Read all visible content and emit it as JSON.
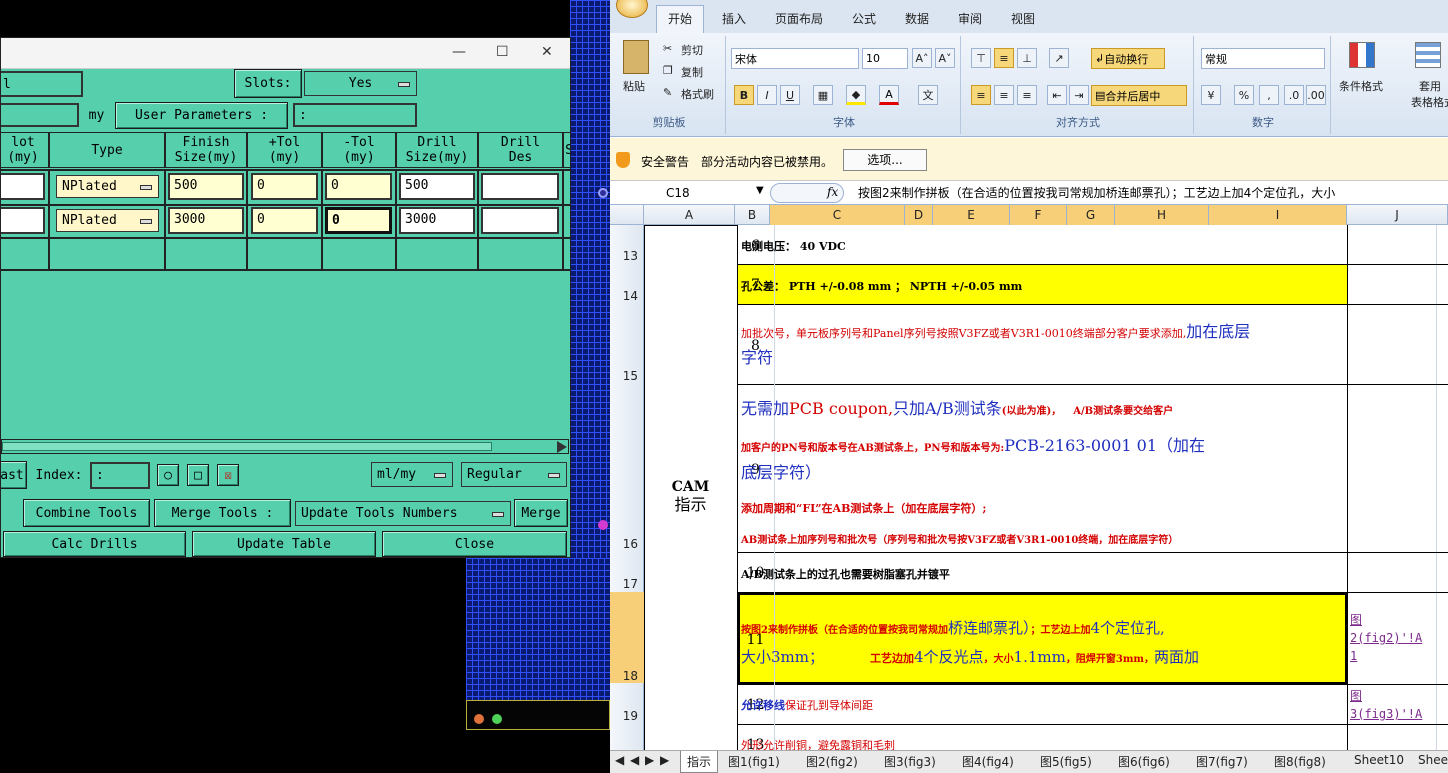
{
  "cam": {
    "row1_field": "l",
    "slots_label": "Slots:",
    "slots_value": "Yes",
    "units_suffix": "my",
    "user_params_label": "User Parameters :",
    "headers": {
      "slot": "lot",
      "slot2": "(my)",
      "type": "Type",
      "finish1": "Finish",
      "finish2": "Size(my)",
      "ptol1": "+Tol",
      "ptol2": "(my)",
      "mtol1": "-Tol",
      "mtol2": "(my)",
      "drill1": "Drill",
      "drill2": "Size(my)",
      "des1": "Drill",
      "des2": "Des",
      "extra": "S"
    },
    "rows": [
      {
        "type": "NPlated",
        "finish": "500",
        "ptol": "0",
        "mtol": "0",
        "drill": "500",
        "des": ""
      },
      {
        "type": "NPlated",
        "finish": "3000",
        "ptol": "0",
        "mtol": "0",
        "drill": "3000",
        "des": ""
      }
    ],
    "bottom": {
      "ast": "ast",
      "index_label": "Index:",
      "units": "ml/my",
      "mode": "Regular",
      "combine": "Combine Tools",
      "merge_tools": "Merge Tools :",
      "update_numbers": "Update Tools Numbers",
      "merge": "Merge",
      "calc": "Calc Drills",
      "update_table": "Update Table",
      "close": "Close"
    }
  },
  "excel": {
    "tabs": [
      "开始",
      "插入",
      "页面布局",
      "公式",
      "数据",
      "审阅",
      "视图"
    ],
    "clipboard": {
      "paste": "粘贴",
      "cut": "剪切",
      "copy": "复制",
      "format_painter": "格式刷",
      "label": "剪贴板"
    },
    "font": {
      "name": "宋体",
      "size": "10",
      "label": "字体"
    },
    "align": {
      "wrap": "自动换行",
      "merge": "合并后居中",
      "label": "对齐方式"
    },
    "number": {
      "format": "常规",
      "label": "数字"
    },
    "styles": {
      "cond": "条件格式",
      "table1": "套用",
      "table2": "表格格式"
    },
    "security": {
      "title": "安全警告",
      "msg": "部分活动内容已被禁用。",
      "btn": "选项..."
    },
    "namebox": "C18",
    "formula": "按图2来制作拼板（在合适的位置按我司常规加桥连邮票孔）；工艺边上加4个定位孔，大小",
    "cols": [
      "A",
      "B",
      "C",
      "D",
      "E",
      "F",
      "G",
      "H",
      "I",
      "J"
    ],
    "rownums": [
      "13",
      "14",
      "15",
      "16",
      "17",
      "18",
      "19"
    ],
    "cam_label1": "CAM",
    "cam_label2": "指示",
    "r6": {
      "n": "6",
      "t": "电测电压： 40 VDC"
    },
    "r7": {
      "n": "7",
      "t": "孔公差： PTH +/-0.08 mm    ；  NPTH +/-0.05 mm"
    },
    "r8": {
      "n": "8",
      "a": "加批次号，单元板序列号和Panel序列号按照V3FZ或者V3R1-0010终端部分客户要求添加,",
      "b": "加在底层",
      "c": "字符"
    },
    "r9": {
      "n": "9",
      "l1a": "无需加",
      "l1b": "PCB coupon,",
      "l1c": "只加A/B测试条",
      "l1d": "(以此为准)，",
      "l1e": "A/B测试条要交给客户",
      "l2a": "加客户的PN号和版本号在AB测试条上，PN号和版本号为:",
      "l2b": "PCB-2163-0001 01（加在",
      "l2c": "底层字符）",
      "l3": "添加周期和“FL”在AB测试条上（加在底层字符）;",
      "l4": "AB测试条上加序列号和批次号（序列号和批次号按V3FZ或者V3R1-0010终端，加在底层字符）"
    },
    "r10": {
      "n": "10",
      "t": "A/B测试条上的过孔也需要树脂塞孔并镀平"
    },
    "r11": {
      "n": "11",
      "a": "按图2来制作拼板（在合适的位置按我司常规加",
      "b": "桥连邮票孔）",
      "c": "；工艺边上加",
      "d": "4个定位孔,",
      "e": "大小3mm；",
      "f": "工艺边加",
      "g": "4个反光点",
      "h": "，大小",
      "i": "1.1mm",
      "j": "，阻焊开窗3mm，",
      "k": "两面加",
      "link1": "图",
      "link1b": "2(fig2)'!A",
      "link1c": "1"
    },
    "r12": {
      "n": "12",
      "a": "允许移线",
      "b": "保证孔到导体间距",
      "link1": "图",
      "link1b": "3(fig3)'!A"
    },
    "r13": {
      "n": "13",
      "t": "外形允许削铜，避免露铜和毛刺"
    },
    "sheets": [
      "指示",
      "图1(fig1)",
      "图2(fig2)",
      "图3(fig3)",
      "图4(fig4)",
      "图5(fig5)",
      "图6(fig6)",
      "图7(fig7)",
      "图8(fig8)",
      "Sheet10",
      "Shee"
    ]
  }
}
